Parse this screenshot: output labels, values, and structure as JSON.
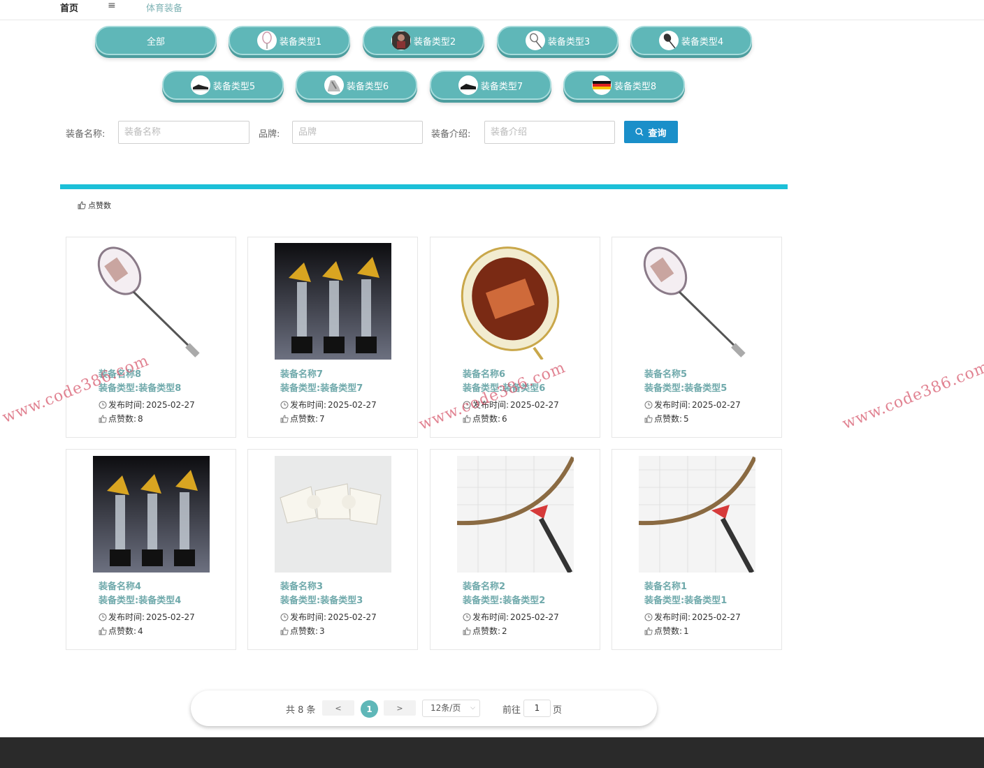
{
  "topbar": {
    "home": "首页",
    "menu_icon": "≡",
    "crumb": "体育装备"
  },
  "categories": [
    {
      "label": "全部",
      "icon": "none"
    },
    {
      "label": "装备类型1",
      "icon": "racket-icon"
    },
    {
      "label": "装备类型2",
      "icon": "player-icon"
    },
    {
      "label": "装备类型3",
      "icon": "racket-icon"
    },
    {
      "label": "装备类型4",
      "icon": "racket-icon"
    },
    {
      "label": "装备类型5",
      "icon": "shoe-icon"
    },
    {
      "label": "装备类型6",
      "icon": "shoe-icon"
    },
    {
      "label": "装备类型7",
      "icon": "shoe-icon"
    },
    {
      "label": "装备类型8",
      "icon": "flag-icon"
    }
  ],
  "search": {
    "name_label": "装备名称:",
    "name_placeholder": "装备名称",
    "brand_label": "品牌:",
    "brand_placeholder": "品牌",
    "intro_label": "装备介绍:",
    "intro_placeholder": "装备介绍",
    "button": "查询"
  },
  "sort": {
    "label": "点赞数"
  },
  "labels": {
    "time_prefix": "发布时间:",
    "likes_prefix": "点赞数:"
  },
  "items": [
    {
      "name": "装备名称8",
      "type": "装备类型:装备类型8",
      "time": "2025-02-27",
      "likes": "8",
      "image": "racket-photo"
    },
    {
      "name": "装备名称7",
      "type": "装备类型:装备类型7",
      "time": "2025-02-27",
      "likes": "7",
      "image": "trophy-photo"
    },
    {
      "name": "装备名称6",
      "type": "装备类型:装备类型6",
      "time": "2025-02-27",
      "likes": "6",
      "image": "racket-head-photo"
    },
    {
      "name": "装备名称5",
      "type": "装备类型:装备类型5",
      "time": "2025-02-27",
      "likes": "5",
      "image": "racket-photo"
    },
    {
      "name": "装备名称4",
      "type": "装备类型:装备类型4",
      "time": "2025-02-27",
      "likes": "4",
      "image": "trophy-photo"
    },
    {
      "name": "装备名称3",
      "type": "装备类型:装备类型3",
      "time": "2025-02-27",
      "likes": "3",
      "image": "shuttlecock-photo"
    },
    {
      "name": "装备名称2",
      "type": "装备类型:装备类型2",
      "time": "2025-02-27",
      "likes": "2",
      "image": "racket-closeup-photo"
    },
    {
      "name": "装备名称1",
      "type": "装备类型:装备类型1",
      "time": "2025-02-27",
      "likes": "1",
      "image": "racket-closeup-photo"
    }
  ],
  "pagination": {
    "total": "共 8 条",
    "prev": "<",
    "current": "1",
    "next": ">",
    "page_size": "12条/页",
    "goto": "前往",
    "goto_value": "1",
    "unit": "页"
  },
  "watermark": "www.code386.com",
  "colors": {
    "teal": "#5fb7b8",
    "accent_bar": "#1cc0d8",
    "primary_button": "#1a8fc9",
    "footer": "#2a2a2a"
  }
}
